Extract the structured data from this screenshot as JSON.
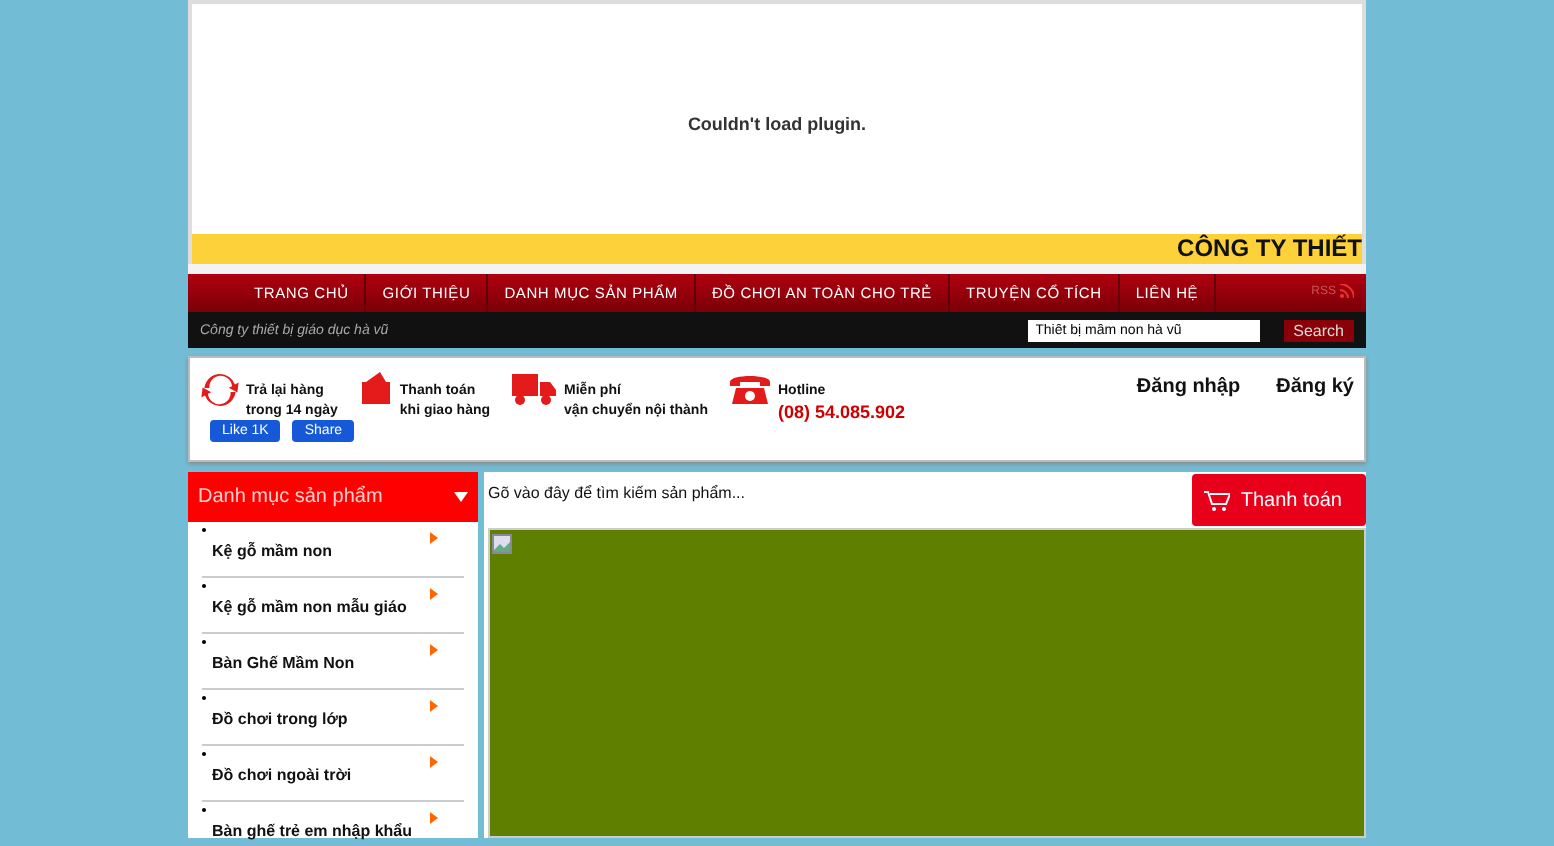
{
  "plugin": {
    "message": "Couldn't load plugin."
  },
  "banner": {
    "text": "CÔNG TY THIẾT"
  },
  "nav": {
    "items": [
      {
        "label": "TRANG CHỦ"
      },
      {
        "label": "GIỚI THIỆU"
      },
      {
        "label": "DANH MỤC SẢN PHẨM"
      },
      {
        "label": "ĐỒ CHƠI AN TOÀN CHO TRẺ"
      },
      {
        "label": "TRUYỆN CỔ TÍCH"
      },
      {
        "label": "LIÊN HỆ"
      }
    ],
    "rss": "RSS"
  },
  "tagline": "Công ty thiết bị giáo dục hà vũ",
  "search": {
    "value": "Thiết bị mầm non hà vũ",
    "button": "Search"
  },
  "features": [
    {
      "kind": "return",
      "title": "Trả lại hàng",
      "subtitle": "trong 14 ngày"
    },
    {
      "kind": "payment",
      "title": "Thanh toán",
      "subtitle": "khi giao hàng"
    },
    {
      "kind": "shipping",
      "title": "Miễn phí",
      "subtitle": "vận chuyển nội thành"
    },
    {
      "kind": "hotline",
      "title": "Hotline",
      "subtitle": "(08) 54.085.902"
    }
  ],
  "social": {
    "like": "Like 1K",
    "share": "Share"
  },
  "account": {
    "login": "Đăng nhập",
    "register": "Đăng ký"
  },
  "categories": {
    "title": "Danh mục sản phẩm",
    "items": [
      {
        "label": "Kệ gỗ mầm non"
      },
      {
        "label": "Kệ gỗ mầm non mẫu giáo"
      },
      {
        "label": "Bàn Ghế Mầm Non"
      },
      {
        "label": "Đồ chơi trong lớp"
      },
      {
        "label": "Đồ chơi ngoài trời"
      },
      {
        "label": "Bàn ghế trẻ em nhập khẩu"
      }
    ]
  },
  "product_search": {
    "placeholder": "Gõ vào đây để tìm kiếm sản phẩm..."
  },
  "checkout": {
    "label": "Thanh toán"
  }
}
